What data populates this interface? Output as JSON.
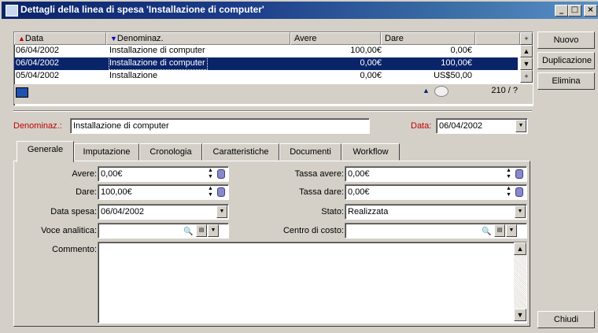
{
  "window": {
    "title": "Dettagli della linea di spesa 'Installazione di computer'",
    "min_glyph": "_",
    "max_glyph": "□",
    "close_glyph": "×"
  },
  "grid": {
    "columns": [
      "Data",
      "Denominaz.",
      "Avere",
      "Dare"
    ],
    "rows": [
      {
        "data": "06/04/2002",
        "denominaz": "Installazione di computer",
        "avere": "100,00€",
        "dare": "0,00€"
      },
      {
        "data": "06/04/2002",
        "denominaz": "Installazione di computer",
        "avere": "0,00€",
        "dare": "100,00€"
      },
      {
        "data": "05/04/2002",
        "denominaz": "Installazione",
        "avere": "0,00€",
        "dare": "US$50,00"
      }
    ],
    "selected_row": 1,
    "counter": "210 / ?"
  },
  "buttons": {
    "nuovo": "Nuovo",
    "duplicazione": "Duplicazione",
    "elimina": "Elimina",
    "chiudi": "Chiudi"
  },
  "header_fields": {
    "denominaz_label": "Denominaz.:",
    "denominaz_value": "Installazione di computer",
    "data_label": "Data:",
    "data_value": "06/04/2002"
  },
  "tabs": [
    "Generale",
    "Imputazione",
    "Cronologia",
    "Caratteristiche",
    "Documenti",
    "Workflow"
  ],
  "active_tab": 0,
  "form": {
    "avere_label": "Avere:",
    "avere_value": "0,00€",
    "dare_label": "Dare:",
    "dare_value": "100,00€",
    "data_spesa_label": "Data spesa:",
    "data_spesa_value": "06/04/2002",
    "voce_label": "Voce analitica:",
    "voce_value": "",
    "commento_label": "Commento:",
    "commento_value": "",
    "tassa_avere_label": "Tassa avere:",
    "tassa_avere_value": "0,00€",
    "tassa_dare_label": "Tassa dare:",
    "tassa_dare_value": "0,00€",
    "stato_label": "Stato:",
    "stato_value": "Realizzata",
    "centro_label": "Centro di costo:",
    "centro_value": ""
  },
  "colors": {
    "title_bar": "#0a246a",
    "selection": "#0a246a",
    "required_label": "#c00000",
    "face": "#d4d0c8"
  }
}
